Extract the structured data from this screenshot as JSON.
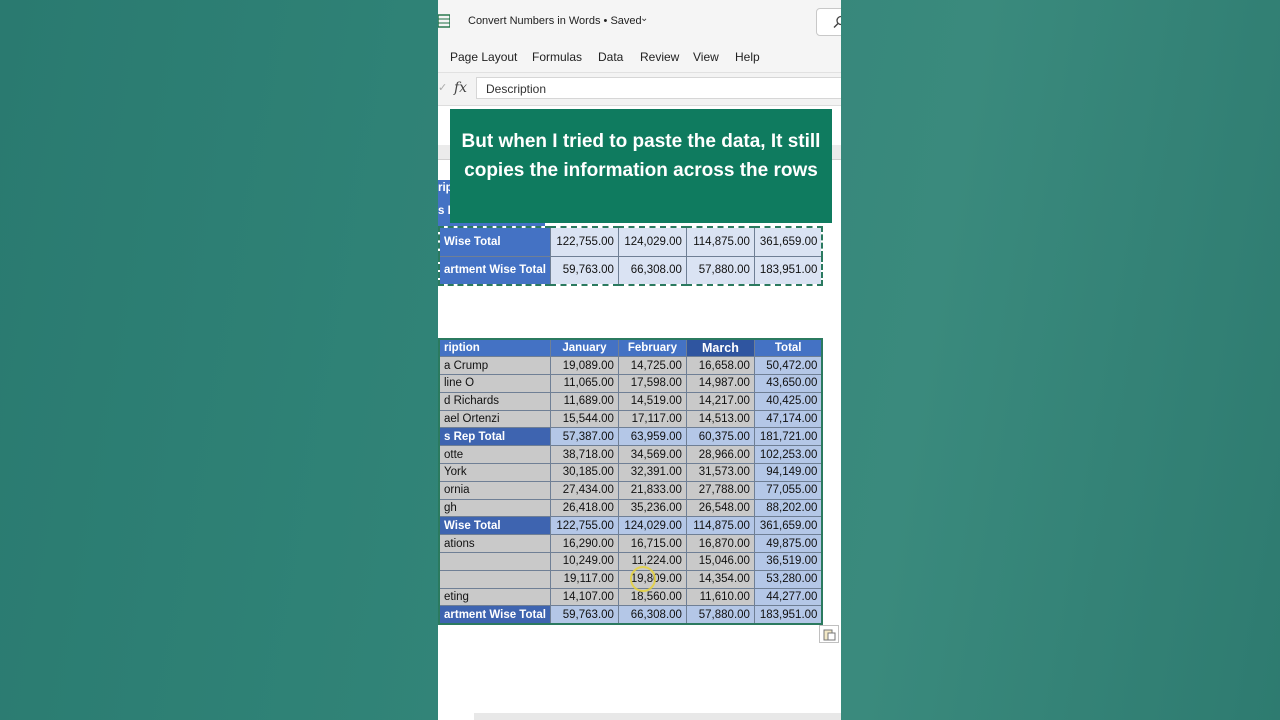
{
  "app": {
    "document_title": "Convert Numbers in Words",
    "saved_status": "Saved"
  },
  "menu": [
    "Page Layout",
    "Formulas",
    "Data",
    "Review",
    "View",
    "Help"
  ],
  "formula_bar": {
    "fx_label": "fx",
    "value": "Description"
  },
  "caption": "But when I tried to paste the data, It still copies the information across the rows",
  "top_table": {
    "partial_labels": [
      "rip",
      "s R"
    ],
    "rows": [
      {
        "label": "Wise Total",
        "values": [
          "122,755.00",
          "124,029.00",
          "114,875.00",
          "361,659.00"
        ]
      },
      {
        "label": "artment Wise Total",
        "values": [
          "59,763.00",
          "66,308.00",
          "57,880.00",
          "183,951.00"
        ]
      }
    ]
  },
  "main_table": {
    "headers": [
      "ription",
      "January",
      "February",
      "March",
      "Total"
    ],
    "rows": [
      {
        "type": "row",
        "label": "a Crump",
        "values": [
          "19,089.00",
          "14,725.00",
          "16,658.00",
          "50,472.00"
        ]
      },
      {
        "type": "row",
        "label": "line O",
        "values": [
          "11,065.00",
          "17,598.00",
          "14,987.00",
          "43,650.00"
        ]
      },
      {
        "type": "row",
        "label": "d Richards",
        "values": [
          "11,689.00",
          "14,519.00",
          "14,217.00",
          "40,425.00"
        ]
      },
      {
        "type": "row",
        "label": "ael Ortenzi",
        "values": [
          "15,544.00",
          "17,117.00",
          "14,513.00",
          "47,174.00"
        ]
      },
      {
        "type": "subtotal",
        "label": "s Rep Total",
        "values": [
          "57,387.00",
          "63,959.00",
          "60,375.00",
          "181,721.00"
        ]
      },
      {
        "type": "row",
        "label": "otte",
        "values": [
          "38,718.00",
          "34,569.00",
          "28,966.00",
          "102,253.00"
        ]
      },
      {
        "type": "row",
        "label": "York",
        "values": [
          "30,185.00",
          "32,391.00",
          "31,573.00",
          "94,149.00"
        ]
      },
      {
        "type": "row",
        "label": "ornia",
        "values": [
          "27,434.00",
          "21,833.00",
          "27,788.00",
          "77,055.00"
        ]
      },
      {
        "type": "row",
        "label": "gh",
        "values": [
          "26,418.00",
          "35,236.00",
          "26,548.00",
          "88,202.00"
        ]
      },
      {
        "type": "subtotal",
        "label": "Wise Total",
        "values": [
          "122,755.00",
          "124,029.00",
          "114,875.00",
          "361,659.00"
        ]
      },
      {
        "type": "row",
        "label": "ations",
        "values": [
          "16,290.00",
          "16,715.00",
          "16,870.00",
          "49,875.00"
        ]
      },
      {
        "type": "row",
        "label": "",
        "values": [
          "10,249.00",
          "11,224.00",
          "15,046.00",
          "36,519.00"
        ]
      },
      {
        "type": "row",
        "label": "",
        "values": [
          "19,117.00",
          "19,809.00",
          "14,354.00",
          "53,280.00"
        ]
      },
      {
        "type": "row",
        "label": "eting",
        "values": [
          "14,107.00",
          "18,560.00",
          "11,610.00",
          "44,277.00"
        ]
      },
      {
        "type": "subtotal",
        "label": "artment Wise Total",
        "values": [
          "59,763.00",
          "66,308.00",
          "57,880.00",
          "183,951.00"
        ]
      }
    ]
  },
  "icons": {
    "app": "excel-icon",
    "search": "search-icon",
    "paste_options": "paste-options-icon"
  },
  "colors": {
    "caption_bg": "#0f7b5f",
    "header_blue": "#4472c4",
    "row_gray": "#c9c9c9",
    "total_light_blue": "#b4c7e7"
  }
}
